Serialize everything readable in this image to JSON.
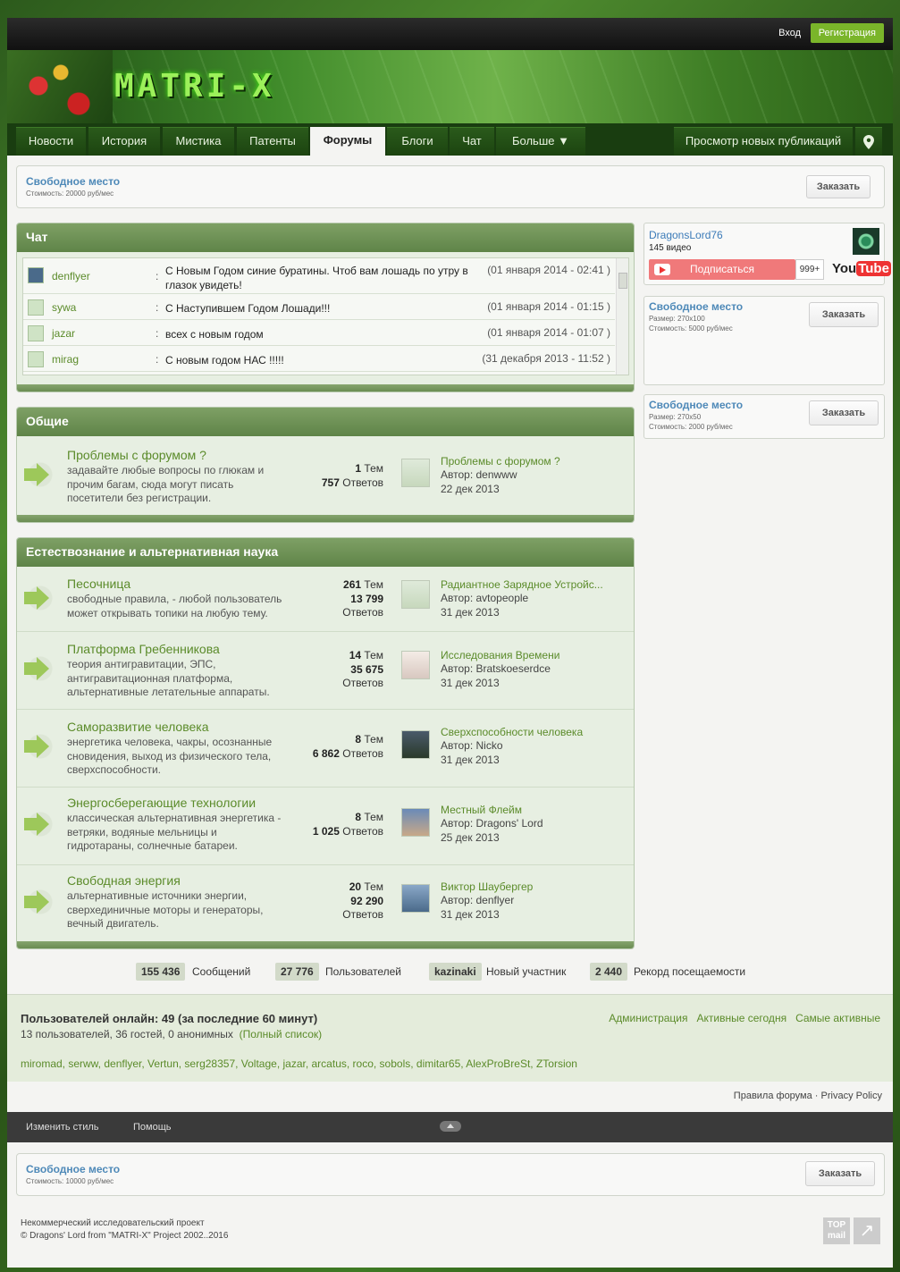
{
  "topbar": {
    "login": "Вход",
    "register": "Регистрация"
  },
  "banner": {
    "logo": "MATRI-X"
  },
  "nav": {
    "tabs": [
      "Новости",
      "История",
      "Мистика",
      "Патенты",
      "Форумы",
      "Блоги",
      "Чат",
      "Больше ▼"
    ],
    "active": "Форумы",
    "new_posts": "Просмотр новых публикаций",
    "map_icon": "map-pin-icon"
  },
  "ad_top": {
    "title": "Свободное место",
    "sub": "Стоимость: 20000 руб/мес",
    "button": "Заказать"
  },
  "chat": {
    "title": "Чат",
    "rows": [
      {
        "user": "denflyer",
        "text": "С Новым Годом синие буратины. Чтоб вам лошадь по утру в глазок увидеть!",
        "date": "(01 января 2014 - 02:41 )"
      },
      {
        "user": "sywa",
        "text": "С Наступившем Годом Лошади!!!",
        "date": "(01 января 2014 - 01:15 )"
      },
      {
        "user": "jazar",
        "text": "всех с новым годом",
        "date": "(01 января 2014 - 01:07 )"
      },
      {
        "user": "mirag",
        "text": "С новым годом НАС !!!!!",
        "date": "(31 декабря 2013 - 11:52 )"
      }
    ]
  },
  "general": {
    "title": "Общие",
    "forums": [
      {
        "title": "Проблемы с форумом ?",
        "desc1": "задавайте любые вопросы по глюкам и",
        "desc2": "прочим багам, сюда могут писать",
        "desc3": "посетители без регистрации.",
        "topics": "1",
        "topics_label": "Тем",
        "replies": "757",
        "replies_label": "Ответов",
        "last_title": "Проблемы с форумом ?",
        "last_author": "Автор: denwww",
        "last_date": "22 дек 2013"
      }
    ]
  },
  "science": {
    "title": "Естествознание и альтернативная наука",
    "forums": [
      {
        "title": "Песочница",
        "desc1": "свободные правила, - любой пользователь",
        "desc2": "может открывать топики на любую тему.",
        "desc3": "",
        "topics": "261",
        "topics_label": "Тем",
        "replies": "13 799",
        "replies_label": "Ответов",
        "last_title": "Радиантное Зарядное Устройс...",
        "last_author": "Автор: avtopeople",
        "last_date": "31 дек 2013"
      },
      {
        "title": "Платформа Гребенникова",
        "desc1": "теория антигравитации, ЭПС,",
        "desc2": "антигравитационная платформа,",
        "desc3": "альтернативные летательные аппараты.",
        "topics": "14",
        "topics_label": "Тем",
        "replies": "35 675",
        "replies_label": "Ответов",
        "last_title": "Исследования Времени",
        "last_author": "Автор: Bratskoeserdce",
        "last_date": "31 дек 2013"
      },
      {
        "title": "Саморазвитие человека",
        "desc1": "энергетика человека, чакры, осознанные",
        "desc2": "сновидения, выход из физического тела,",
        "desc3": "сверхспособности.",
        "topics": "8",
        "topics_label": "Тем",
        "replies": "6 862",
        "replies_label": "Ответов",
        "last_title": "Сверхспособности человека",
        "last_author": "Автор: Nicko",
        "last_date": "31 дек 2013"
      },
      {
        "title": "Энергосберегающие технологии",
        "desc1": "классическая альтернативная энергетика -",
        "desc2": "ветряки, водяные мельницы и",
        "desc3": "гидротараны, солнечные батареи.",
        "topics": "8",
        "topics_label": "Тем",
        "replies": "1 025",
        "replies_label": "Ответов",
        "last_title": "Местный Флейм",
        "last_author": "Автор: Dragons' Lord",
        "last_date": "25 дек 2013"
      },
      {
        "title": "Свободная энергия",
        "desc1": "альтернативные источники энергии,",
        "desc2": "сверхединичные моторы и генераторы,",
        "desc3": "вечный двигатель.",
        "topics": "20",
        "topics_label": "Тем",
        "replies": "92 290",
        "replies_label": "Ответов",
        "last_title": "Виктор Шаубергер",
        "last_author": "Автор: denflyer",
        "last_date": "31 дек 2013"
      }
    ]
  },
  "sidebar": {
    "youtube": {
      "name": "DragonsLord76",
      "videos": "145 видео",
      "subscribe": "Подписаться",
      "count": "999+",
      "logo_you": "You",
      "logo_tube": "Tube"
    },
    "ad1": {
      "title": "Свободное место",
      "size": "Размер: 270x100",
      "cost": "Стоимость: 5000 руб/мес",
      "button": "Заказать"
    },
    "ad2": {
      "title": "Свободное место",
      "size": "Размер: 270x50",
      "cost": "Стоимость: 2000 руб/мес",
      "button": "Заказать"
    }
  },
  "stats": [
    {
      "num": "155 436",
      "label": "Сообщений"
    },
    {
      "num": "27 776",
      "label": "Пользователей"
    },
    {
      "num": "kazinaki",
      "label": "Новый участник"
    },
    {
      "num": "2 440",
      "label": "Рекорд посещаемости"
    }
  ],
  "online": {
    "heading": "Пользователей онлайн: 49 (за последние 60 минут)",
    "sub": "13 пользователей, 36 гостей, 0 анонимных",
    "full_list": "(Полный список)",
    "links": [
      "Администрация",
      "Активные сегодня",
      "Самые активные"
    ],
    "users": "miromad, serww, denflyer, Vertun, serg28357, Voltage, jazar, arcatus, roco, sobols, dimitar65, AlexProBreSt, ZTorsion"
  },
  "footer": {
    "rules": "Правила форума",
    "privacy": "Privacy Policy",
    "change_style": "Изменить стиль",
    "help": "Помощь",
    "ad_title": "Свободное место",
    "ad_sub": "Стоимость: 10000 руб/мес",
    "ad_button": "Заказать",
    "copy1": "Некоммерческий исследовательский проект",
    "copy2": "© Dragons' Lord from \"MATRI-X\" Project 2002..2016",
    "topmail1": "TOP",
    "topmail2": "mail"
  }
}
